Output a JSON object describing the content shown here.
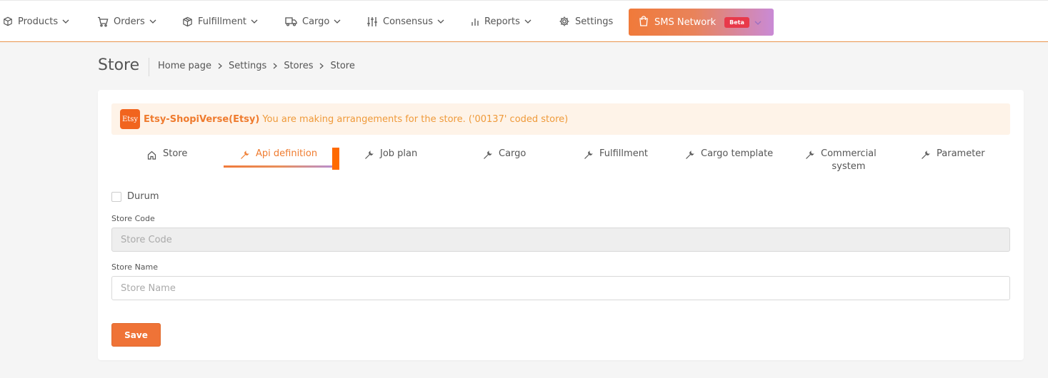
{
  "nav": {
    "items": [
      {
        "label": "Products",
        "icon": "box-icon"
      },
      {
        "label": "Orders",
        "icon": "cart-icon"
      },
      {
        "label": "Fulfillment",
        "icon": "cube-icon"
      },
      {
        "label": "Cargo",
        "icon": "truck-icon"
      },
      {
        "label": "Consensus",
        "icon": "sliders-icon"
      },
      {
        "label": "Reports",
        "icon": "bar-chart-icon"
      },
      {
        "label": "Settings",
        "icon": "gear-icon"
      }
    ],
    "sms": {
      "label": "SMS Network",
      "badge": "Beta",
      "icon": "shopping-bag-icon"
    }
  },
  "page": {
    "title": "Store",
    "breadcrumb": [
      "Home page",
      "Settings",
      "Stores",
      "Store"
    ]
  },
  "notice": {
    "logo_text": "Etsy",
    "store_name": "Etsy-ShopiVerse(Etsy)",
    "message": "You are making arrangements for the store. ('00137' coded store)"
  },
  "tabs": [
    {
      "label": "Store",
      "icon": "home-icon",
      "active": false
    },
    {
      "label": "Api definition",
      "icon": "wrench-icon",
      "active": true
    },
    {
      "label": "Job plan",
      "icon": "wrench-icon",
      "active": false
    },
    {
      "label": "Cargo",
      "icon": "wrench-icon",
      "active": false
    },
    {
      "label": "Fulfillment",
      "icon": "wrench-icon",
      "active": false
    },
    {
      "label": "Cargo template",
      "icon": "wrench-icon",
      "active": false
    },
    {
      "label": "Commercial system",
      "line1": "Commercial",
      "line2": "system",
      "icon": "wrench-icon",
      "active": false
    },
    {
      "label": "Parameter",
      "icon": "wrench-icon",
      "active": false
    }
  ],
  "form": {
    "status_label": "Durum",
    "status_checked": false,
    "store_code_label": "Store Code",
    "store_code_placeholder": "Store Code",
    "store_code_value": "",
    "store_name_label": "Store Name",
    "store_name_placeholder": "Store Name",
    "store_name_value": "",
    "save_label": "Save"
  },
  "colors": {
    "accent": "#ef7b2e",
    "notice_bg": "#fef3e8",
    "beta_badge": "#e8394a"
  }
}
